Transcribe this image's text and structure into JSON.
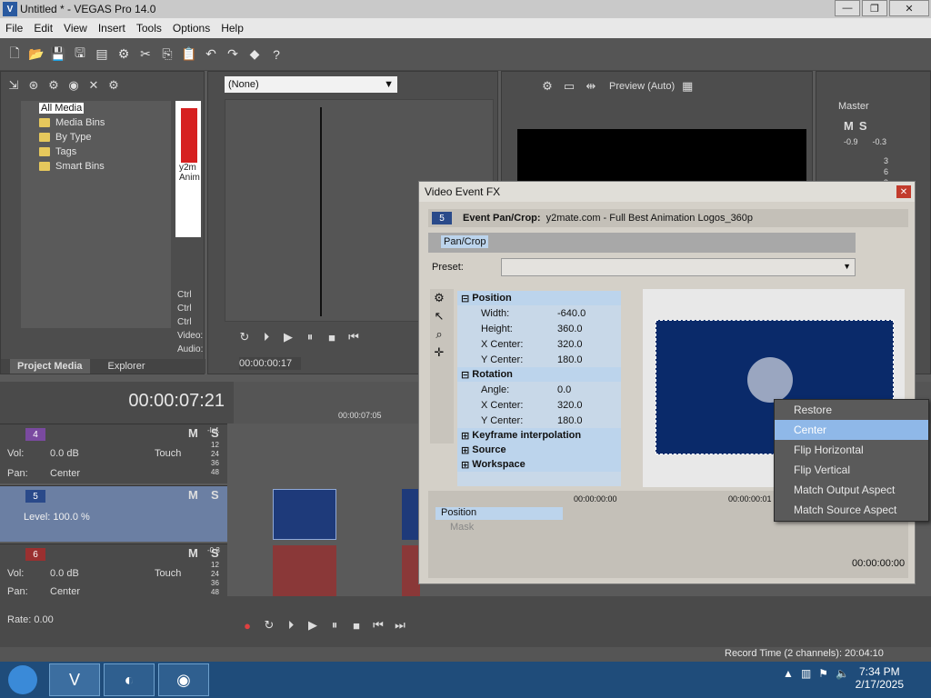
{
  "window": {
    "title": "Untitled * - VEGAS Pro 14.0",
    "logo_text": "V"
  },
  "menu": [
    "File",
    "Edit",
    "View",
    "Insert",
    "Tools",
    "Options",
    "Help"
  ],
  "explorer": {
    "tree": [
      "All Media",
      "Media Bins",
      "By Type",
      "Tags",
      "Smart Bins"
    ],
    "thumb_caption": "y2m\nAnim",
    "side_list": [
      "Ctrl",
      "Ctrl",
      "Ctrl"
    ],
    "video_label": "Video:",
    "audio_label": "Audio:",
    "tabs": [
      "Project Media",
      "Explorer"
    ]
  },
  "trimmer": {
    "dropdown": "(None)",
    "timecode": "00:00:00:17"
  },
  "preview": {
    "mode": "Preview (Auto)"
  },
  "master": {
    "label": "Master",
    "levels": [
      "-0.9",
      "-0.3"
    ],
    "scale": [
      "3",
      "6",
      "9"
    ]
  },
  "timeline": {
    "cursor_time": "00:00:07:21",
    "ruler_mark": "00:00:07:05",
    "rate_label": "Rate: 0.00",
    "record_time": "Record Time (2 channels): 20:04:10",
    "tracks": [
      {
        "num": "4",
        "vol_label": "Vol:",
        "vol": "0.0 dB",
        "pan_label": "Pan:",
        "pan": "Center",
        "touch": "Touch",
        "meter_top": "-Inf.",
        "meter": [
          "12",
          "24",
          "36",
          "48"
        ]
      },
      {
        "num": "5",
        "level": "Level: 100.0 %"
      },
      {
        "num": "6",
        "vol_label": "Vol:",
        "vol": "0.0 dB",
        "pan_label": "Pan:",
        "pan": "Center",
        "touch": "Touch",
        "meter_top": "-0.3",
        "meter": [
          "12",
          "24",
          "36",
          "48"
        ]
      }
    ]
  },
  "dialog": {
    "title": "Video Event FX",
    "event_num": "5",
    "header_label": "Event Pan/Crop:",
    "header_value": "y2mate.com - Full Best Animation Logos_360p",
    "chain_item": "Pan/Crop",
    "preset_label": "Preset:",
    "sections": {
      "position": {
        "label": "Position",
        "props": [
          {
            "k": "Width:",
            "v": "-640.0"
          },
          {
            "k": "Height:",
            "v": "360.0"
          },
          {
            "k": "X Center:",
            "v": "320.0"
          },
          {
            "k": "Y Center:",
            "v": "180.0"
          }
        ]
      },
      "rotation": {
        "label": "Rotation",
        "props": [
          {
            "k": "Angle:",
            "v": "0.0"
          },
          {
            "k": "X Center:",
            "v": "320.0"
          },
          {
            "k": "Y Center:",
            "v": "180.0"
          }
        ]
      },
      "keyframe": "Keyframe interpolation",
      "source": "Source",
      "workspace": "Workspace"
    },
    "kf_track": "Position",
    "kf_mask": "Mask",
    "kf_time_start": "00:00:00:00",
    "kf_time_mid": "00:00:00:01",
    "kf_time": "00:00:00:00"
  },
  "context_menu": [
    "Restore",
    "Center",
    "Flip Horizontal",
    "Flip Vertical",
    "Match Output Aspect",
    "Match Source Aspect"
  ],
  "context_highlight": "Center",
  "taskbar": {
    "time": "7:34 PM",
    "date": "2/17/2025"
  }
}
